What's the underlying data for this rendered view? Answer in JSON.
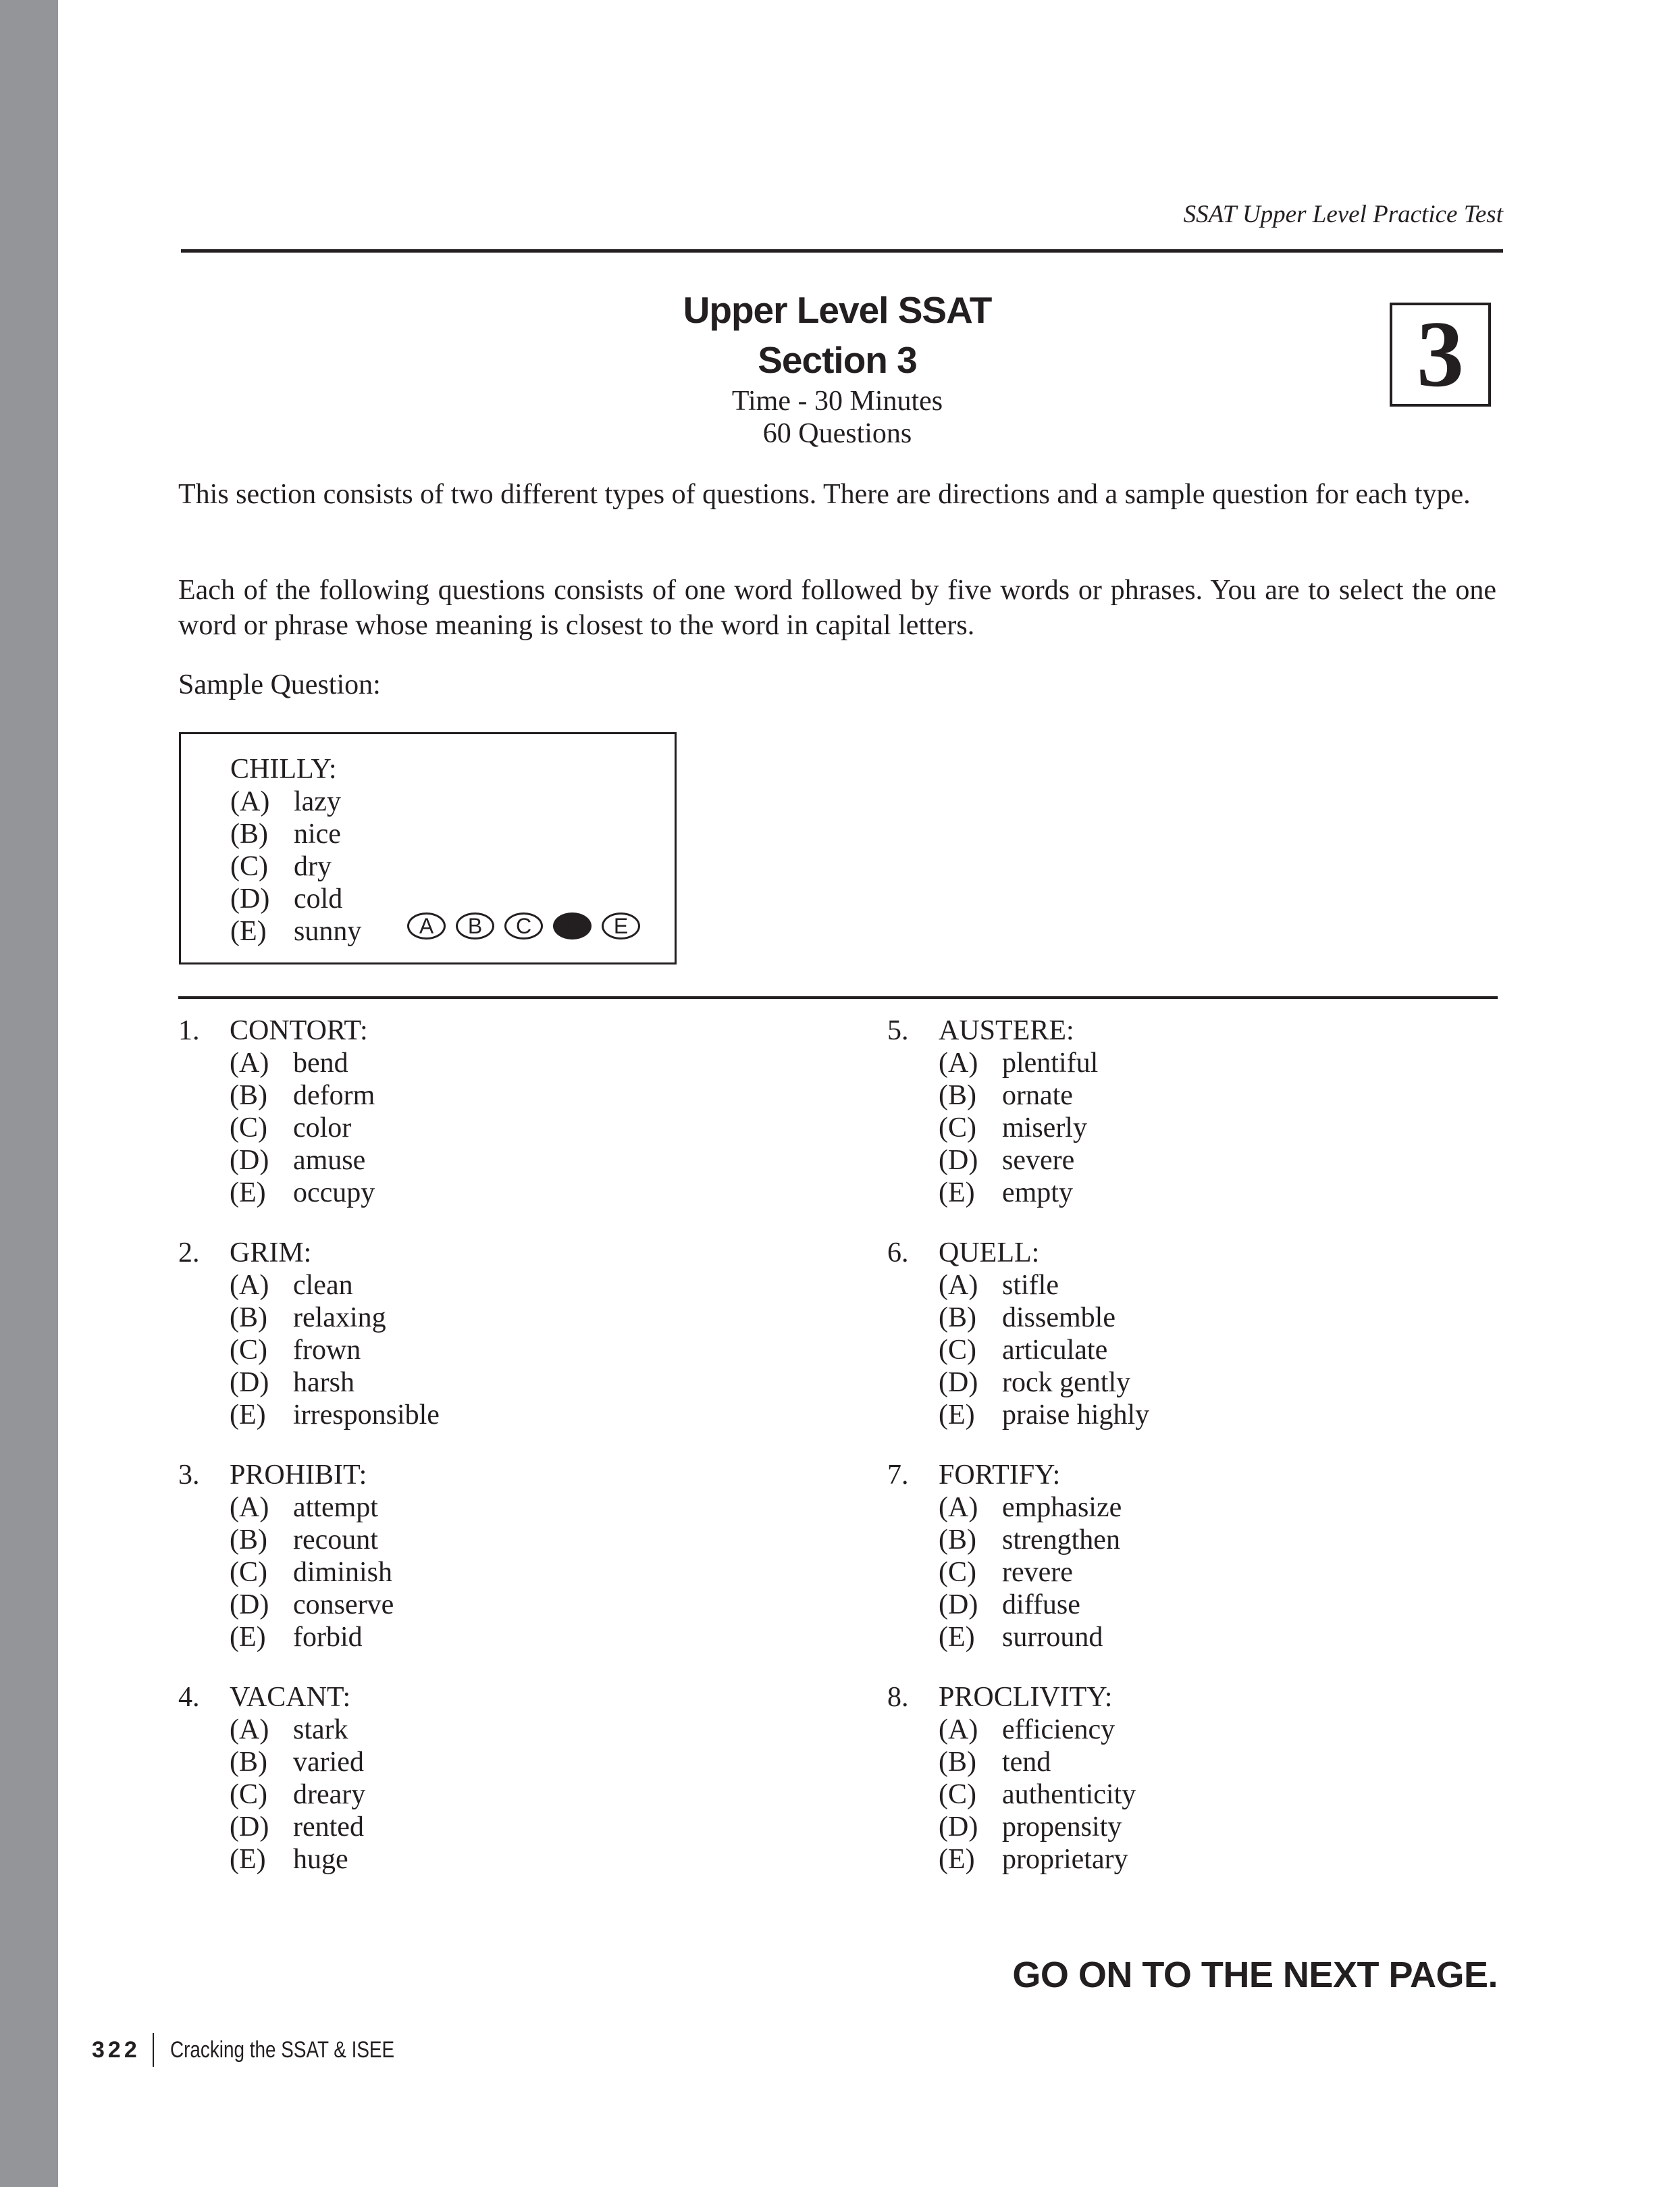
{
  "running_head": "SSAT Upper Level Practice Test",
  "title": {
    "line1": "Upper Level SSAT",
    "line2": "Section 3",
    "time": "Time - 30 Minutes",
    "count": "60 Questions"
  },
  "section_number": "3",
  "instructions": {
    "intro": "This section consists of two different types of questions. There are directions and a sample question for each type.",
    "directions": "Each of the following questions consists of one word followed by five words or phrases. You are to select the one word or phrase whose meaning is closest to the word in capital letters.",
    "sample_label": "Sample Question:"
  },
  "sample": {
    "stem": "CHILLY:",
    "choices": [
      {
        "letter": "(A)",
        "text": "lazy"
      },
      {
        "letter": "(B)",
        "text": "nice"
      },
      {
        "letter": "(C)",
        "text": "dry"
      },
      {
        "letter": "(D)",
        "text": "cold"
      },
      {
        "letter": "(E)",
        "text": "sunny"
      }
    ],
    "bubbles": [
      "A",
      "B",
      "C",
      "D",
      "E"
    ],
    "answer": "D"
  },
  "questions": [
    {
      "number": "1.",
      "stem": "CONTORT:",
      "choices": [
        {
          "letter": "(A)",
          "text": "bend"
        },
        {
          "letter": "(B)",
          "text": "deform"
        },
        {
          "letter": "(C)",
          "text": "color"
        },
        {
          "letter": "(D)",
          "text": "amuse"
        },
        {
          "letter": "(E)",
          "text": "occupy"
        }
      ]
    },
    {
      "number": "2.",
      "stem": "GRIM:",
      "choices": [
        {
          "letter": "(A)",
          "text": "clean"
        },
        {
          "letter": "(B)",
          "text": "relaxing"
        },
        {
          "letter": "(C)",
          "text": "frown"
        },
        {
          "letter": "(D)",
          "text": "harsh"
        },
        {
          "letter": "(E)",
          "text": "irresponsible"
        }
      ]
    },
    {
      "number": "3.",
      "stem": "PROHIBIT:",
      "choices": [
        {
          "letter": "(A)",
          "text": "attempt"
        },
        {
          "letter": "(B)",
          "text": "recount"
        },
        {
          "letter": "(C)",
          "text": "diminish"
        },
        {
          "letter": "(D)",
          "text": "conserve"
        },
        {
          "letter": "(E)",
          "text": "forbid"
        }
      ]
    },
    {
      "number": "4.",
      "stem": "VACANT:",
      "choices": [
        {
          "letter": "(A)",
          "text": "stark"
        },
        {
          "letter": "(B)",
          "text": "varied"
        },
        {
          "letter": "(C)",
          "text": "dreary"
        },
        {
          "letter": "(D)",
          "text": "rented"
        },
        {
          "letter": "(E)",
          "text": "huge"
        }
      ]
    },
    {
      "number": "5.",
      "stem": "AUSTERE:",
      "choices": [
        {
          "letter": "(A)",
          "text": "plentiful"
        },
        {
          "letter": "(B)",
          "text": "ornate"
        },
        {
          "letter": "(C)",
          "text": "miserly"
        },
        {
          "letter": "(D)",
          "text": "severe"
        },
        {
          "letter": "(E)",
          "text": "empty"
        }
      ]
    },
    {
      "number": "6.",
      "stem": "QUELL:",
      "choices": [
        {
          "letter": "(A)",
          "text": "stifle"
        },
        {
          "letter": "(B)",
          "text": "dissemble"
        },
        {
          "letter": "(C)",
          "text": "articulate"
        },
        {
          "letter": "(D)",
          "text": "rock gently"
        },
        {
          "letter": "(E)",
          "text": "praise highly"
        }
      ]
    },
    {
      "number": "7.",
      "stem": "FORTIFY:",
      "choices": [
        {
          "letter": "(A)",
          "text": "emphasize"
        },
        {
          "letter": "(B)",
          "text": "strengthen"
        },
        {
          "letter": "(C)",
          "text": "revere"
        },
        {
          "letter": "(D)",
          "text": "diffuse"
        },
        {
          "letter": "(E)",
          "text": "surround"
        }
      ]
    },
    {
      "number": "8.",
      "stem": "PROCLIVITY:",
      "choices": [
        {
          "letter": "(A)",
          "text": "efficiency"
        },
        {
          "letter": "(B)",
          "text": "tend"
        },
        {
          "letter": "(C)",
          "text": "authenticity"
        },
        {
          "letter": "(D)",
          "text": "propensity"
        },
        {
          "letter": "(E)",
          "text": "proprietary"
        }
      ]
    }
  ],
  "go_on": "GO ON TO THE NEXT PAGE.",
  "footer": {
    "page_number": "322",
    "book_title": "Cracking the SSAT & ISEE"
  }
}
